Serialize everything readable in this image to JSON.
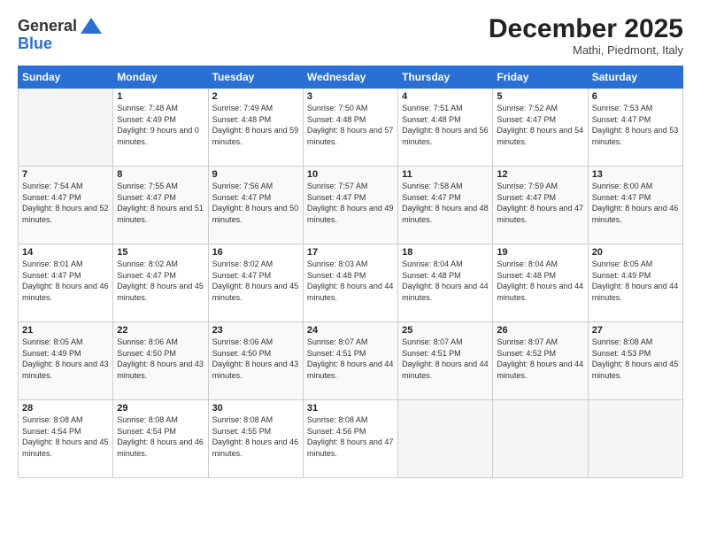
{
  "logo": {
    "general": "General",
    "blue": "Blue"
  },
  "header": {
    "title": "December 2025",
    "location": "Mathi, Piedmont, Italy"
  },
  "days_of_week": [
    "Sunday",
    "Monday",
    "Tuesday",
    "Wednesday",
    "Thursday",
    "Friday",
    "Saturday"
  ],
  "weeks": [
    [
      {
        "day": "",
        "sunrise": "",
        "sunset": "",
        "daylight": ""
      },
      {
        "day": "1",
        "sunrise": "Sunrise: 7:48 AM",
        "sunset": "Sunset: 4:49 PM",
        "daylight": "Daylight: 9 hours and 0 minutes."
      },
      {
        "day": "2",
        "sunrise": "Sunrise: 7:49 AM",
        "sunset": "Sunset: 4:48 PM",
        "daylight": "Daylight: 8 hours and 59 minutes."
      },
      {
        "day": "3",
        "sunrise": "Sunrise: 7:50 AM",
        "sunset": "Sunset: 4:48 PM",
        "daylight": "Daylight: 8 hours and 57 minutes."
      },
      {
        "day": "4",
        "sunrise": "Sunrise: 7:51 AM",
        "sunset": "Sunset: 4:48 PM",
        "daylight": "Daylight: 8 hours and 56 minutes."
      },
      {
        "day": "5",
        "sunrise": "Sunrise: 7:52 AM",
        "sunset": "Sunset: 4:47 PM",
        "daylight": "Daylight: 8 hours and 54 minutes."
      },
      {
        "day": "6",
        "sunrise": "Sunrise: 7:53 AM",
        "sunset": "Sunset: 4:47 PM",
        "daylight": "Daylight: 8 hours and 53 minutes."
      }
    ],
    [
      {
        "day": "7",
        "sunrise": "Sunrise: 7:54 AM",
        "sunset": "Sunset: 4:47 PM",
        "daylight": "Daylight: 8 hours and 52 minutes."
      },
      {
        "day": "8",
        "sunrise": "Sunrise: 7:55 AM",
        "sunset": "Sunset: 4:47 PM",
        "daylight": "Daylight: 8 hours and 51 minutes."
      },
      {
        "day": "9",
        "sunrise": "Sunrise: 7:56 AM",
        "sunset": "Sunset: 4:47 PM",
        "daylight": "Daylight: 8 hours and 50 minutes."
      },
      {
        "day": "10",
        "sunrise": "Sunrise: 7:57 AM",
        "sunset": "Sunset: 4:47 PM",
        "daylight": "Daylight: 8 hours and 49 minutes."
      },
      {
        "day": "11",
        "sunrise": "Sunrise: 7:58 AM",
        "sunset": "Sunset: 4:47 PM",
        "daylight": "Daylight: 8 hours and 48 minutes."
      },
      {
        "day": "12",
        "sunrise": "Sunrise: 7:59 AM",
        "sunset": "Sunset: 4:47 PM",
        "daylight": "Daylight: 8 hours and 47 minutes."
      },
      {
        "day": "13",
        "sunrise": "Sunrise: 8:00 AM",
        "sunset": "Sunset: 4:47 PM",
        "daylight": "Daylight: 8 hours and 46 minutes."
      }
    ],
    [
      {
        "day": "14",
        "sunrise": "Sunrise: 8:01 AM",
        "sunset": "Sunset: 4:47 PM",
        "daylight": "Daylight: 8 hours and 46 minutes."
      },
      {
        "day": "15",
        "sunrise": "Sunrise: 8:02 AM",
        "sunset": "Sunset: 4:47 PM",
        "daylight": "Daylight: 8 hours and 45 minutes."
      },
      {
        "day": "16",
        "sunrise": "Sunrise: 8:02 AM",
        "sunset": "Sunset: 4:47 PM",
        "daylight": "Daylight: 8 hours and 45 minutes."
      },
      {
        "day": "17",
        "sunrise": "Sunrise: 8:03 AM",
        "sunset": "Sunset: 4:48 PM",
        "daylight": "Daylight: 8 hours and 44 minutes."
      },
      {
        "day": "18",
        "sunrise": "Sunrise: 8:04 AM",
        "sunset": "Sunset: 4:48 PM",
        "daylight": "Daylight: 8 hours and 44 minutes."
      },
      {
        "day": "19",
        "sunrise": "Sunrise: 8:04 AM",
        "sunset": "Sunset: 4:48 PM",
        "daylight": "Daylight: 8 hours and 44 minutes."
      },
      {
        "day": "20",
        "sunrise": "Sunrise: 8:05 AM",
        "sunset": "Sunset: 4:49 PM",
        "daylight": "Daylight: 8 hours and 44 minutes."
      }
    ],
    [
      {
        "day": "21",
        "sunrise": "Sunrise: 8:05 AM",
        "sunset": "Sunset: 4:49 PM",
        "daylight": "Daylight: 8 hours and 43 minutes."
      },
      {
        "day": "22",
        "sunrise": "Sunrise: 8:06 AM",
        "sunset": "Sunset: 4:50 PM",
        "daylight": "Daylight: 8 hours and 43 minutes."
      },
      {
        "day": "23",
        "sunrise": "Sunrise: 8:06 AM",
        "sunset": "Sunset: 4:50 PM",
        "daylight": "Daylight: 8 hours and 43 minutes."
      },
      {
        "day": "24",
        "sunrise": "Sunrise: 8:07 AM",
        "sunset": "Sunset: 4:51 PM",
        "daylight": "Daylight: 8 hours and 44 minutes."
      },
      {
        "day": "25",
        "sunrise": "Sunrise: 8:07 AM",
        "sunset": "Sunset: 4:51 PM",
        "daylight": "Daylight: 8 hours and 44 minutes."
      },
      {
        "day": "26",
        "sunrise": "Sunrise: 8:07 AM",
        "sunset": "Sunset: 4:52 PM",
        "daylight": "Daylight: 8 hours and 44 minutes."
      },
      {
        "day": "27",
        "sunrise": "Sunrise: 8:08 AM",
        "sunset": "Sunset: 4:53 PM",
        "daylight": "Daylight: 8 hours and 45 minutes."
      }
    ],
    [
      {
        "day": "28",
        "sunrise": "Sunrise: 8:08 AM",
        "sunset": "Sunset: 4:54 PM",
        "daylight": "Daylight: 8 hours and 45 minutes."
      },
      {
        "day": "29",
        "sunrise": "Sunrise: 8:08 AM",
        "sunset": "Sunset: 4:54 PM",
        "daylight": "Daylight: 8 hours and 46 minutes."
      },
      {
        "day": "30",
        "sunrise": "Sunrise: 8:08 AM",
        "sunset": "Sunset: 4:55 PM",
        "daylight": "Daylight: 8 hours and 46 minutes."
      },
      {
        "day": "31",
        "sunrise": "Sunrise: 8:08 AM",
        "sunset": "Sunset: 4:56 PM",
        "daylight": "Daylight: 8 hours and 47 minutes."
      },
      {
        "day": "",
        "sunrise": "",
        "sunset": "",
        "daylight": ""
      },
      {
        "day": "",
        "sunrise": "",
        "sunset": "",
        "daylight": ""
      },
      {
        "day": "",
        "sunrise": "",
        "sunset": "",
        "daylight": ""
      }
    ]
  ]
}
